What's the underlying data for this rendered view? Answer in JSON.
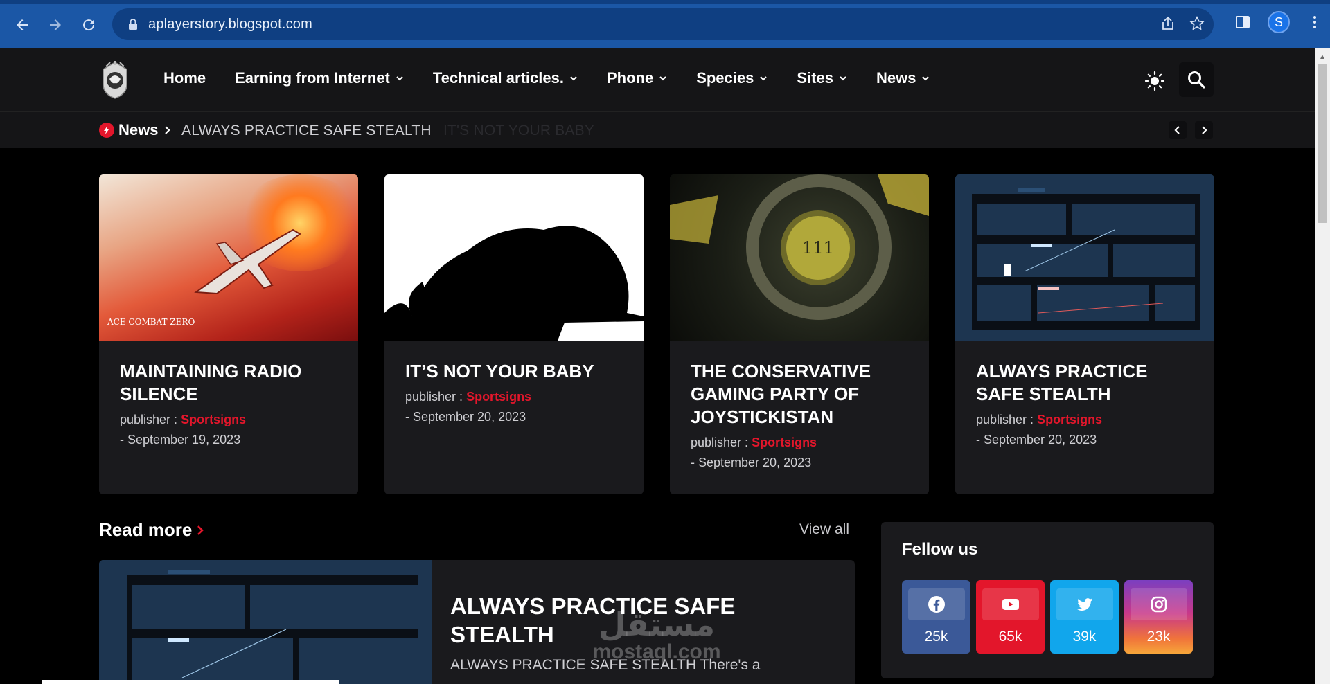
{
  "browser": {
    "url": "aplayerstory.blogspot.com",
    "profile_initial": "S"
  },
  "nav": {
    "items": [
      {
        "label": "Home",
        "has_dropdown": false
      },
      {
        "label": "Earning from Internet",
        "has_dropdown": true
      },
      {
        "label": "Technical articles.",
        "has_dropdown": true
      },
      {
        "label": "Phone",
        "has_dropdown": true
      },
      {
        "label": "Species",
        "has_dropdown": true
      },
      {
        "label": "Sites",
        "has_dropdown": true
      },
      {
        "label": "News",
        "has_dropdown": true
      }
    ]
  },
  "ticker": {
    "label": "News",
    "headline": "ALWAYS PRACTICE SAFE STEALTH",
    "next_headline_faded": "IT'S NOT YOUR BABY"
  },
  "cards": [
    {
      "title": "MAINTAINING RADIO SILENCE",
      "publisher_prefix": "publisher : ",
      "publisher": "Sportsigns",
      "date": "- September 19, 2023",
      "thumb_caption": "ACE COMBAT ZERO"
    },
    {
      "title": "IT’S NOT YOUR BABY",
      "publisher_prefix": "publisher : ",
      "publisher": "Sportsigns",
      "date": "- September 20, 2023"
    },
    {
      "title": "THE CONSERVATIVE GAMING PARTY OF JOYSTICKISTAN",
      "publisher_prefix": "publisher : ",
      "publisher": "Sportsigns",
      "date": "- September 20, 2023",
      "thumb_caption": "111"
    },
    {
      "title": "ALWAYS PRACTICE SAFE STEALTH",
      "publisher_prefix": "publisher : ",
      "publisher": "Sportsigns",
      "date": "- September 20, 2023"
    }
  ],
  "section": {
    "title": "Read more",
    "view_all": "View all"
  },
  "feature": {
    "title": "ALWAYS PRACTICE SAFE STEALTH",
    "excerpt": "ALWAYS PRACTICE SAFE STEALTH There's a"
  },
  "watermark": {
    "arabic": "مستقل",
    "latin": "mostaql.com"
  },
  "follow": {
    "title": "Fellow us",
    "socials": [
      {
        "name": "facebook",
        "count": "25k",
        "icon": "facebook-icon",
        "color": "#3b5998"
      },
      {
        "name": "youtube",
        "count": "65k",
        "icon": "youtube-icon",
        "color": "#e3162b"
      },
      {
        "name": "twitter",
        "count": "39k",
        "icon": "twitter-icon",
        "color": "#11a6ec"
      },
      {
        "name": "instagram",
        "count": "23k",
        "icon": "instagram-icon",
        "color": "#c8388a"
      }
    ]
  },
  "colors": {
    "accent": "#e3162b",
    "panel": "#1a1a1d",
    "header": "#151517"
  }
}
